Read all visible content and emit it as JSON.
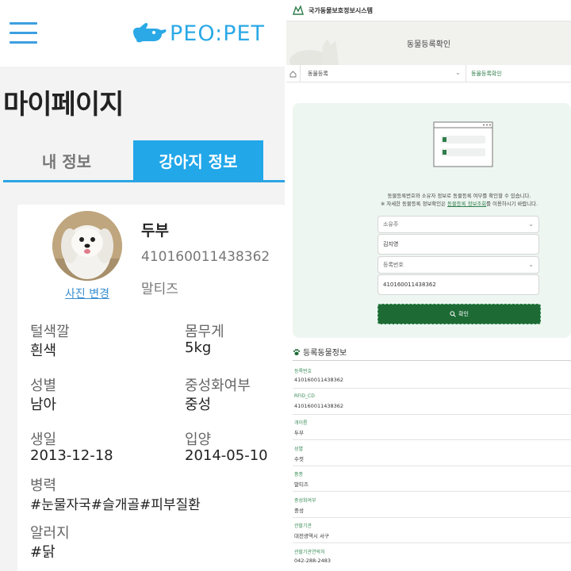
{
  "left": {
    "logo_text": "PEO:PET",
    "page_title": "마이페이지",
    "tabs": [
      "내 정보",
      "강아지 정보"
    ],
    "photo_change": "사진 변경",
    "dog": {
      "name": "두부",
      "reg_number": "410160011438362",
      "breed": "말티즈"
    },
    "fields": {
      "fur_color": {
        "label": "털색깔",
        "value": "흰색"
      },
      "weight": {
        "label": "몸무게",
        "value": "5kg"
      },
      "gender": {
        "label": "성별",
        "value": "남아"
      },
      "neutered": {
        "label": "중성화여부",
        "value": "중성"
      },
      "birth": {
        "label": "생일",
        "value": "2013-12-18"
      },
      "adopted": {
        "label": "입양",
        "value": "2014-05-10"
      },
      "history": {
        "label": "병력",
        "value": "#눈물자국#슬개골#피부질환"
      },
      "allergy": {
        "label": "알러지",
        "value": "#닭"
      }
    }
  },
  "right": {
    "system_title": "국가동물보호정보시스템",
    "banner_title": "동물등록확인",
    "breadcrumb": [
      "동물등록",
      "동물등록확인"
    ],
    "desc_line1": "동물등록번호와 소유자 정보로 동물등록 여부를 확인할 수 있습니다.",
    "desc_line2_pre": "※ 자세한 동물등록 정보확인은 ",
    "desc_line2_link": "동물등록 정보조회",
    "desc_line2_post": "를 이용하시기 바랍니다.",
    "form": {
      "owner_select": "소유주",
      "owner_value": "김지영",
      "regno_select": "등록번호",
      "regno_value": "410160011438362",
      "confirm_button": "확인"
    },
    "section_title": "등록동물정보",
    "rows": [
      {
        "label": "등록번호",
        "value": "410160011438362"
      },
      {
        "label": "RFID_CD",
        "value": "410160011438362"
      },
      {
        "label": "개이름",
        "value": "두부"
      },
      {
        "label": "성별",
        "value": "수컷"
      },
      {
        "label": "품종",
        "value": "말티즈"
      },
      {
        "label": "중성화여부",
        "value": "중성"
      },
      {
        "label": "관할기관",
        "value": "대전광역시 서구"
      },
      {
        "label": "관할기관연락처",
        "value": "042-288-2483"
      }
    ]
  },
  "colors": {
    "left_accent": "#22a7e9",
    "right_accent": "#1d6a35"
  }
}
